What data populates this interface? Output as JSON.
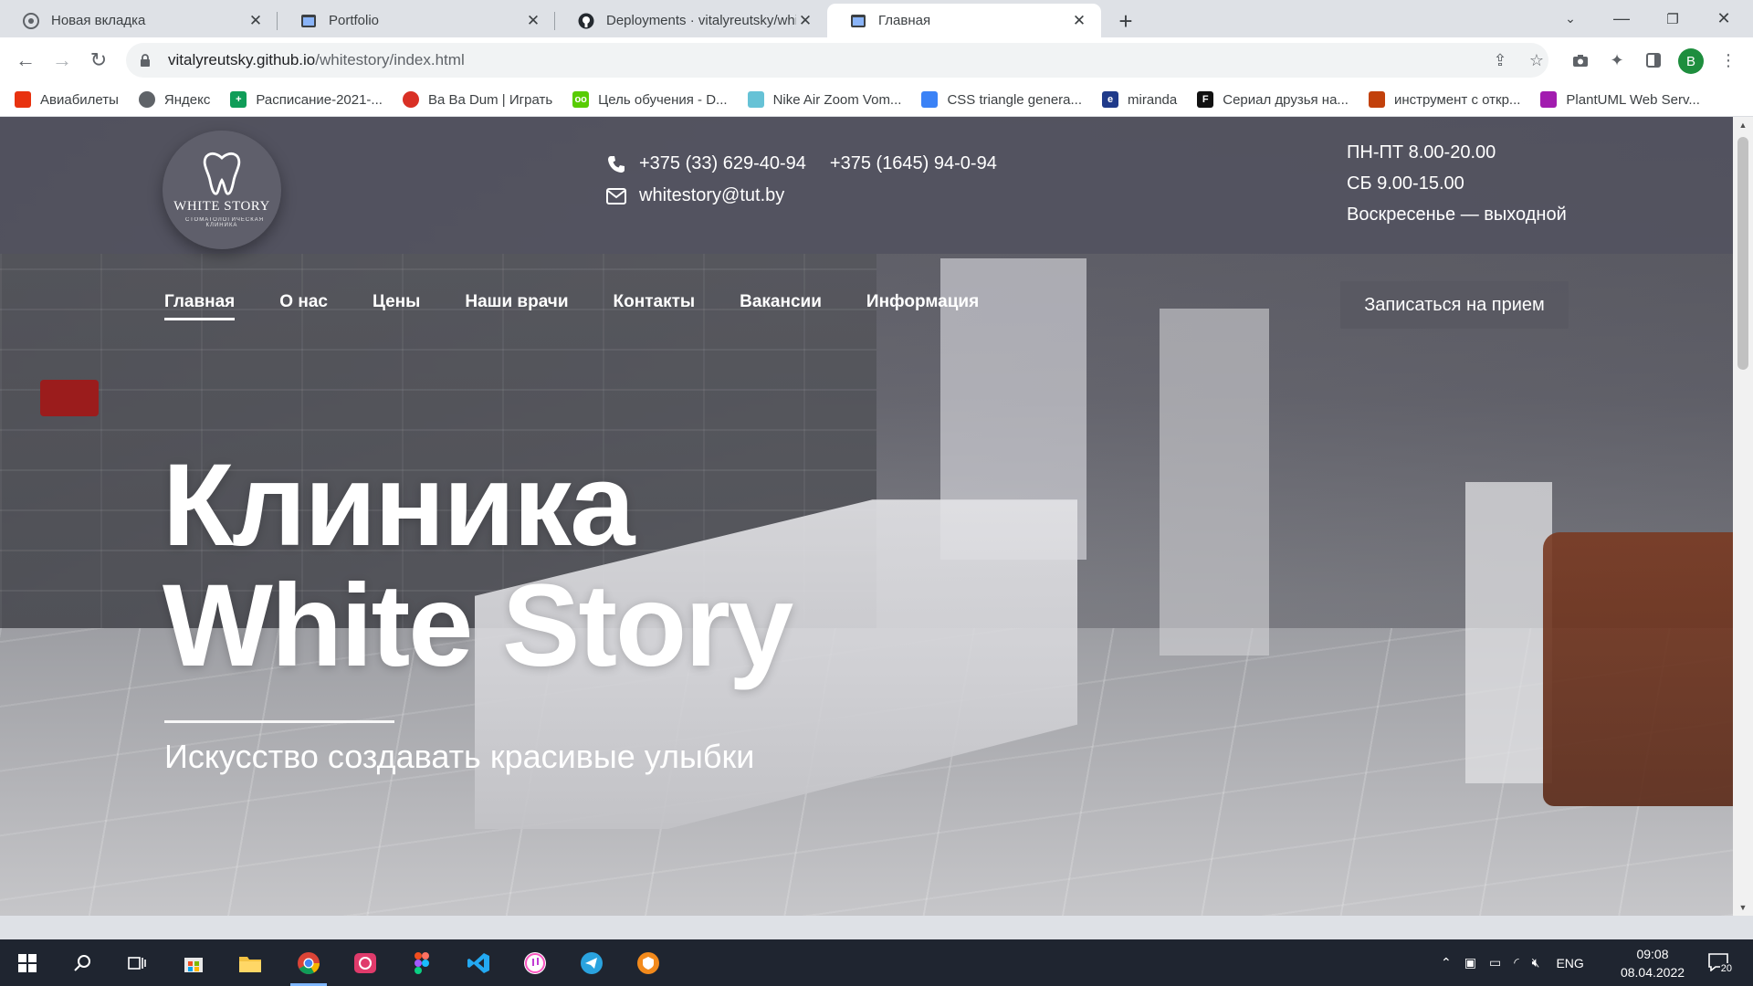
{
  "browser": {
    "tabs": [
      {
        "title": "Новая вкладка",
        "icon": "chrome-icon",
        "active": false
      },
      {
        "title": "Portfolio",
        "icon": "page-icon",
        "active": false
      },
      {
        "title": "Deployments · vitalyreutsky/whit",
        "icon": "github-icon",
        "active": false
      },
      {
        "title": "Главная",
        "icon": "page-icon",
        "active": true
      }
    ],
    "url_host": "vitalyreutsky.github.io",
    "url_path": "/whitestory/index.html",
    "profile_initial": "В",
    "bookmarks": [
      {
        "label": "Авиабилеты",
        "color": "#e8320f"
      },
      {
        "label": "Яндекс",
        "color": "#5f6368"
      },
      {
        "label": "Расписание-2021-...",
        "color": "#0f9d58"
      },
      {
        "label": "Ba Ba Dum | Играть",
        "color": "#d93025"
      },
      {
        "label": "Цель обучения - D...",
        "color": "#58cc02"
      },
      {
        "label": "Nike Air Zoom Vom...",
        "color": "#66c2d6"
      },
      {
        "label": "CSS triangle genera...",
        "color": "#3b82f6"
      },
      {
        "label": "miranda",
        "color": "#1f3a8a"
      },
      {
        "label": "Сериал друзья на...",
        "color": "#111111"
      },
      {
        "label": "инструмент с откр...",
        "color": "#c2410c"
      },
      {
        "label": "PlantUML Web Serv...",
        "color": "#a21caf"
      }
    ]
  },
  "site": {
    "logo": {
      "brand": "WHITE STORY",
      "sub": "СТОМАТОЛОГИЧЕСКАЯ КЛИНИКА"
    },
    "phone1": "+375 (33) 629-40-94",
    "phone2": "+375 (1645) 94-0-94",
    "email": "whitestory@tut.by",
    "hours": [
      "ПН-ПТ 8.00-20.00",
      "СБ 9.00-15.00",
      "Воскресенье — выходной"
    ],
    "menu": [
      {
        "label": "Главная",
        "active": true
      },
      {
        "label": "О нас"
      },
      {
        "label": "Цены"
      },
      {
        "label": "Наши врачи"
      },
      {
        "label": "Контакты"
      },
      {
        "label": "Вакансии"
      },
      {
        "label": "Информация"
      }
    ],
    "cta": "Записаться на прием",
    "title_line1": "Клиника",
    "title_line2": "White Story",
    "tagline": "Искусство создавать красивые улыбки"
  },
  "taskbar": {
    "lang": "ENG",
    "time": "09:08",
    "date": "08.04.2022",
    "notifications": "20",
    "apps": [
      "windows-start-icon",
      "search-icon",
      "task-view-icon",
      "store-icon",
      "file-explorer-icon",
      "chrome-icon",
      "creative-cloud-icon",
      "figma-icon",
      "vscode-icon",
      "itunes-icon",
      "telegram-icon",
      "vpn-icon"
    ]
  },
  "colors": {
    "header": "#525260",
    "taskbar": "#1f2530",
    "accent": "#ffffff"
  }
}
